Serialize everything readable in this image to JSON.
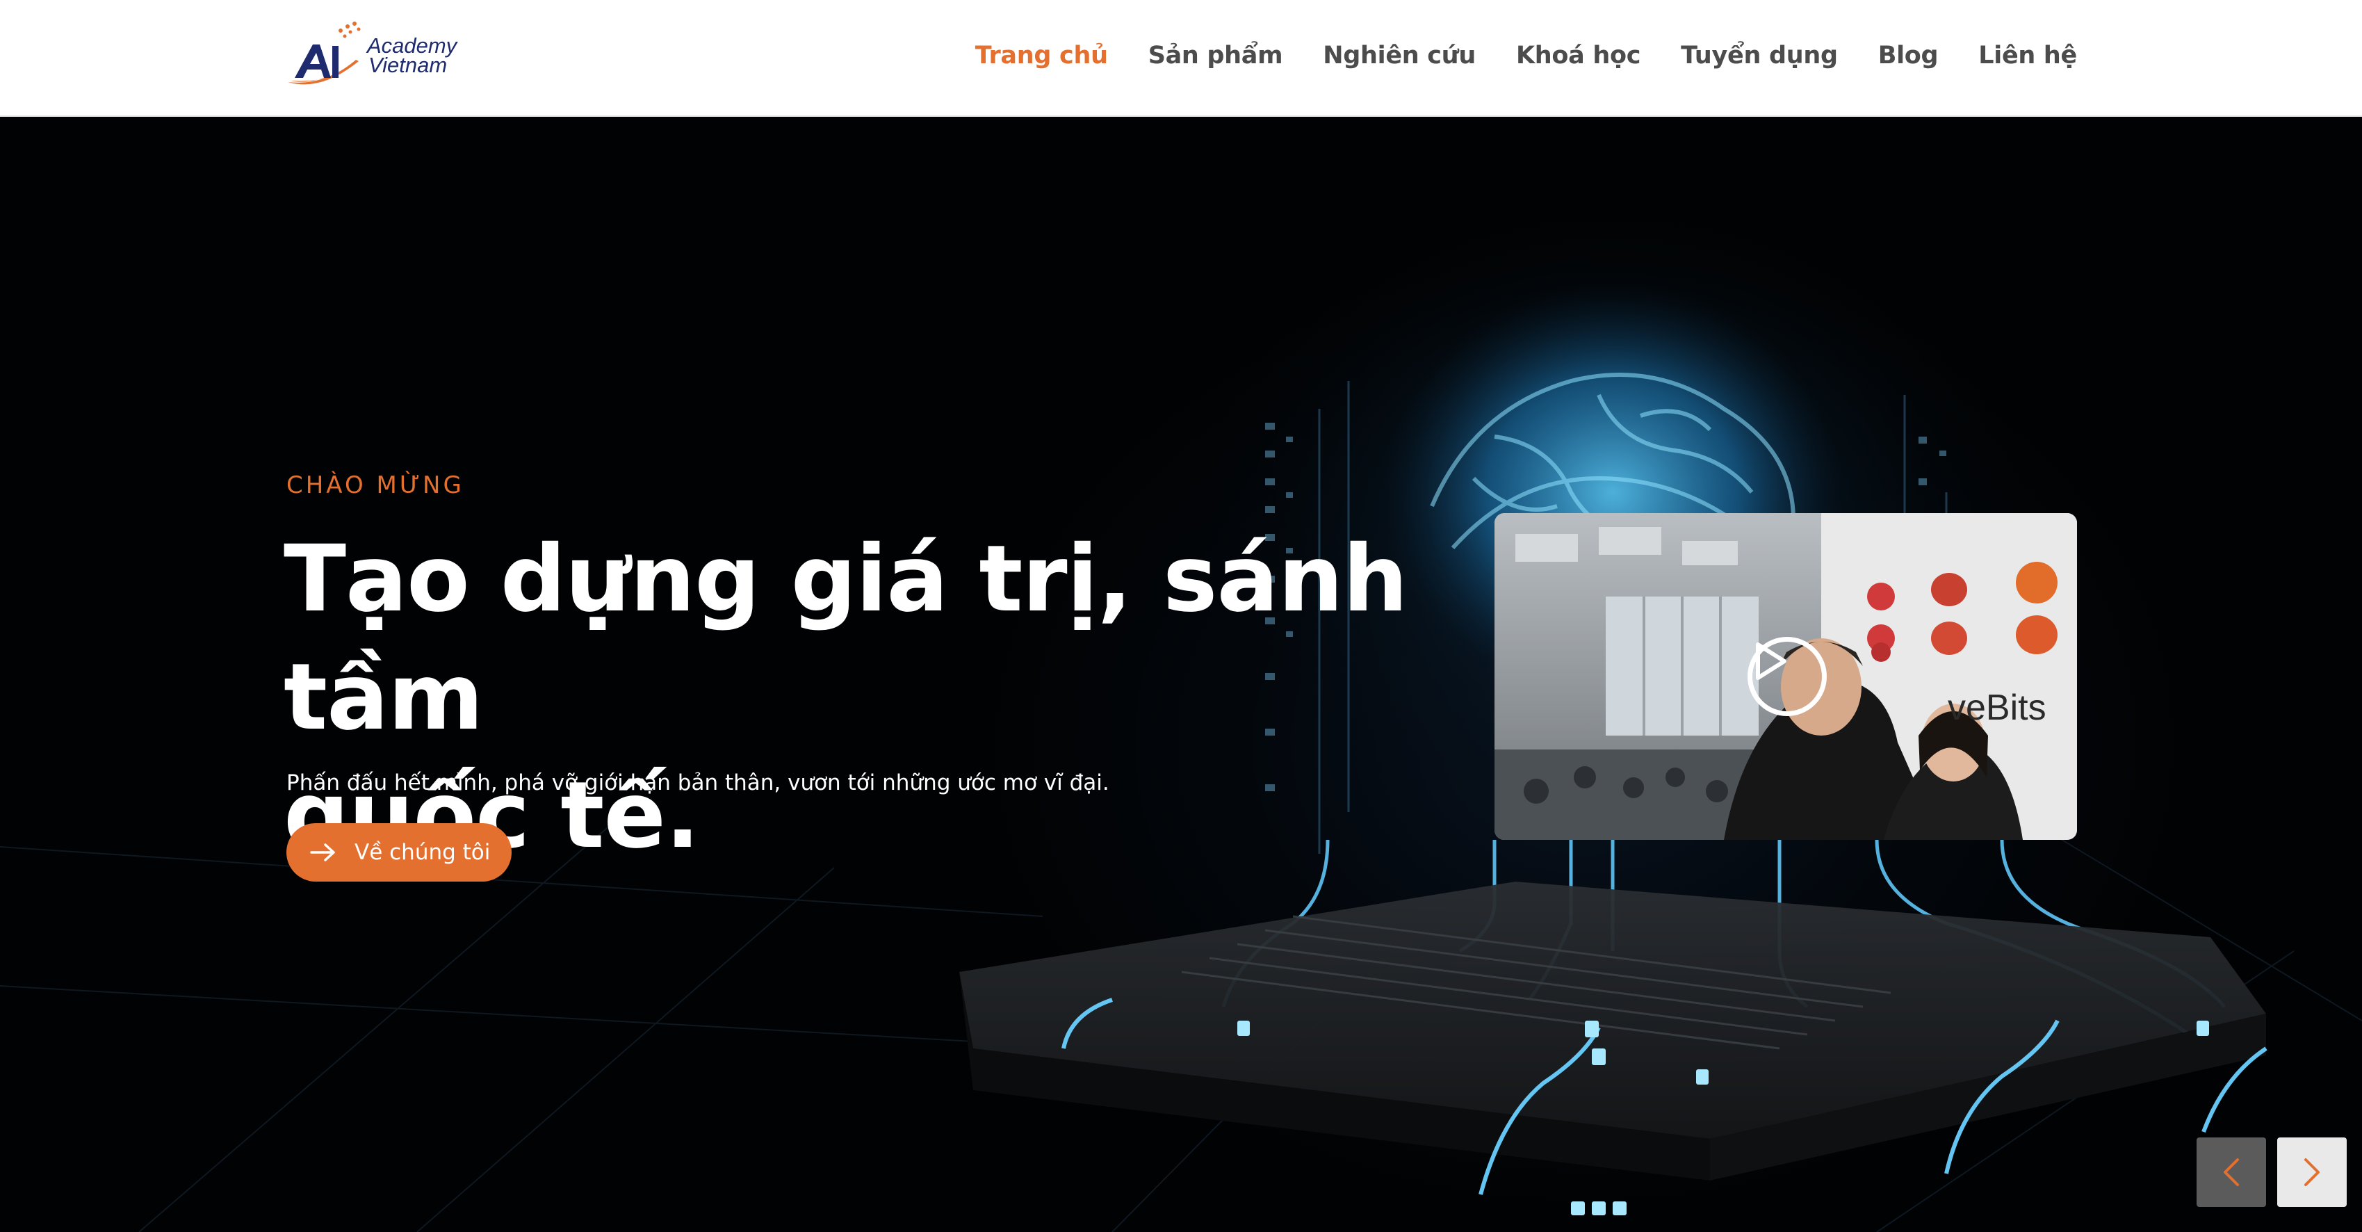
{
  "header": {
    "logo": {
      "line1": "Academy",
      "line2": "Vietnam",
      "mark": "AI"
    },
    "nav": [
      {
        "label": "Trang chủ",
        "active": true
      },
      {
        "label": "Sản phẩm",
        "active": false
      },
      {
        "label": "Nghiên cứu",
        "active": false
      },
      {
        "label": "Khoá học",
        "active": false
      },
      {
        "label": "Tuyển dụng",
        "active": false
      },
      {
        "label": "Blog",
        "active": false
      },
      {
        "label": "Liên hệ",
        "active": false
      }
    ]
  },
  "hero": {
    "kicker": "CHÀO MỪNG",
    "headline_line1": "Tạo dựng giá trị, sánh tầm",
    "headline_line2": "quốc tế.",
    "subtext": "Phấn đấu hết mình, phá vỡ giới hạn bản thân, vươn tới những ước mơ vĩ đại.",
    "cta_label": "Về chúng tôi",
    "video": {
      "brand_text": "veBits",
      "play_icon": "play-circle-icon"
    }
  },
  "slider": {
    "prev_icon": "chevron-left-icon",
    "next_icon": "chevron-right-icon"
  },
  "colors": {
    "accent": "#e4702f",
    "navy": "#1e2b6e",
    "text": "#4c4c4c",
    "hero_bg": "#020408",
    "glow": "#3ab0e8"
  }
}
